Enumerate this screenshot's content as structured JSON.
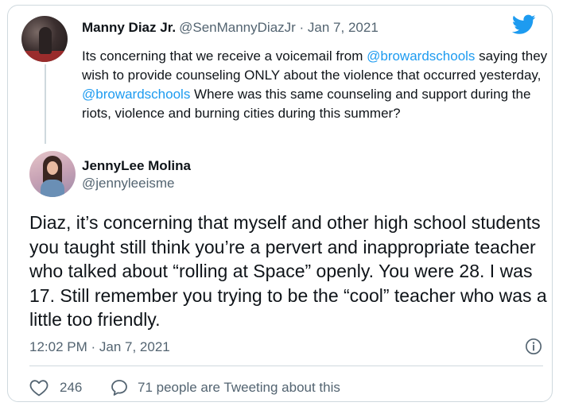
{
  "parent_tweet": {
    "author_name": "Manny Diaz Jr.",
    "meta": "@SenMannyDiazJr · Jan 7, 2021",
    "text_parts": [
      "Its concerning that we receive a voicemail from ",
      "@browardschools",
      " saying they wish to provide counseling ONLY about the violence that occurred yesterday, ",
      "@browardschools",
      " Where was this same counseling and support during the riots, violence and burning cities during this summer?"
    ]
  },
  "reply": {
    "author_name": "JennyLee Molina",
    "handle": "@jennyleeisme",
    "text": "Diaz, it’s concerning that myself and other high school students you taught still think you’re a pervert and inappropriate teacher who talked about “rolling at Space” openly. You were 28. I was 17. Still remember you trying to be the “cool” teacher who was a little too friendly.",
    "timestamp": "12:02 PM · Jan 7, 2021"
  },
  "actions": {
    "like_count": "246",
    "comment_text": "71 people are Tweeting about this"
  },
  "colors": {
    "link": "#1d9bf0",
    "secondary_text": "#536471",
    "border": "#cfd9de",
    "brand": "#1d9bf0"
  },
  "icons": [
    "twitter-bird-icon",
    "info-icon",
    "heart-icon",
    "comment-bubble-icon"
  ]
}
